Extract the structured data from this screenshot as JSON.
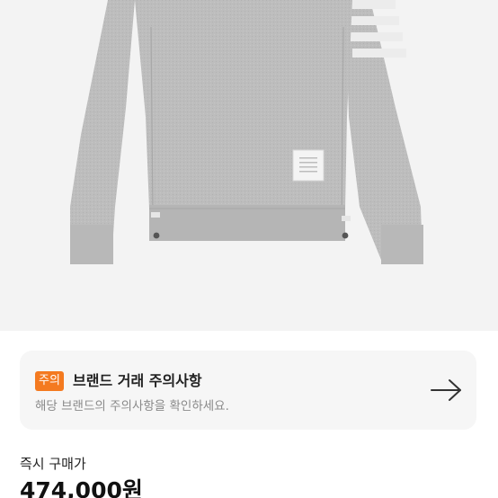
{
  "notice": {
    "badge": "주의",
    "title": "브랜드 거래 주의사항",
    "description": "해당 브랜드의 주의사항을 확인하세요.",
    "arrow_icon": "arrow-right-icon"
  },
  "purchase": {
    "label": "즉시 구매가",
    "price": "474,000원"
  },
  "colors": {
    "badge": "#f47a20",
    "card_background": "#f6f6f6",
    "photo_background": "#f3f3f3",
    "sweater_gray": "#bdbdbd"
  }
}
